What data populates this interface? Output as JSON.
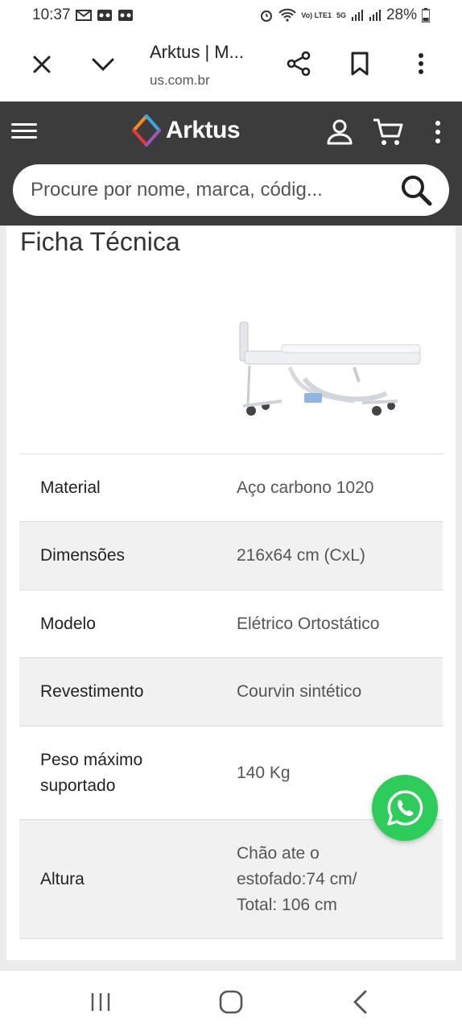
{
  "status_bar": {
    "time": "10:37",
    "battery": "28%",
    "network_label": "5G",
    "volte_label": "Vo) LTE1"
  },
  "browser": {
    "title": "Arktus | M...",
    "url": "us.com.br",
    "icons": [
      "close-icon",
      "chevron-down-icon",
      "share-icon",
      "bookmark-icon",
      "more-vert-icon"
    ]
  },
  "site": {
    "logo_text": "Arktus",
    "search_placeholder": "Procure por nome, marca, códig...",
    "colors": {
      "header_bg": "#3c3c3c",
      "logo_orange": "#f28c28",
      "logo_red": "#e23b3b",
      "logo_blue": "#39a9dc"
    }
  },
  "spec": {
    "section_title": "Ficha Técnica",
    "rows": [
      {
        "label": "Material",
        "value": "Aço carbono 1020"
      },
      {
        "label": "Dimensões",
        "value": "216x64 cm (CxL)"
      },
      {
        "label": "Modelo",
        "value": "Elétrico Ortostático"
      },
      {
        "label": "Revestimento",
        "value": "Courvin sintético"
      },
      {
        "label": "Peso máximo suportado",
        "value": "140 Kg"
      },
      {
        "label": "Altura",
        "value": "Chão ate o estofado:74 cm/ Total: 106 cm"
      }
    ]
  },
  "whatsapp": {
    "color": "#2ecc5a"
  }
}
